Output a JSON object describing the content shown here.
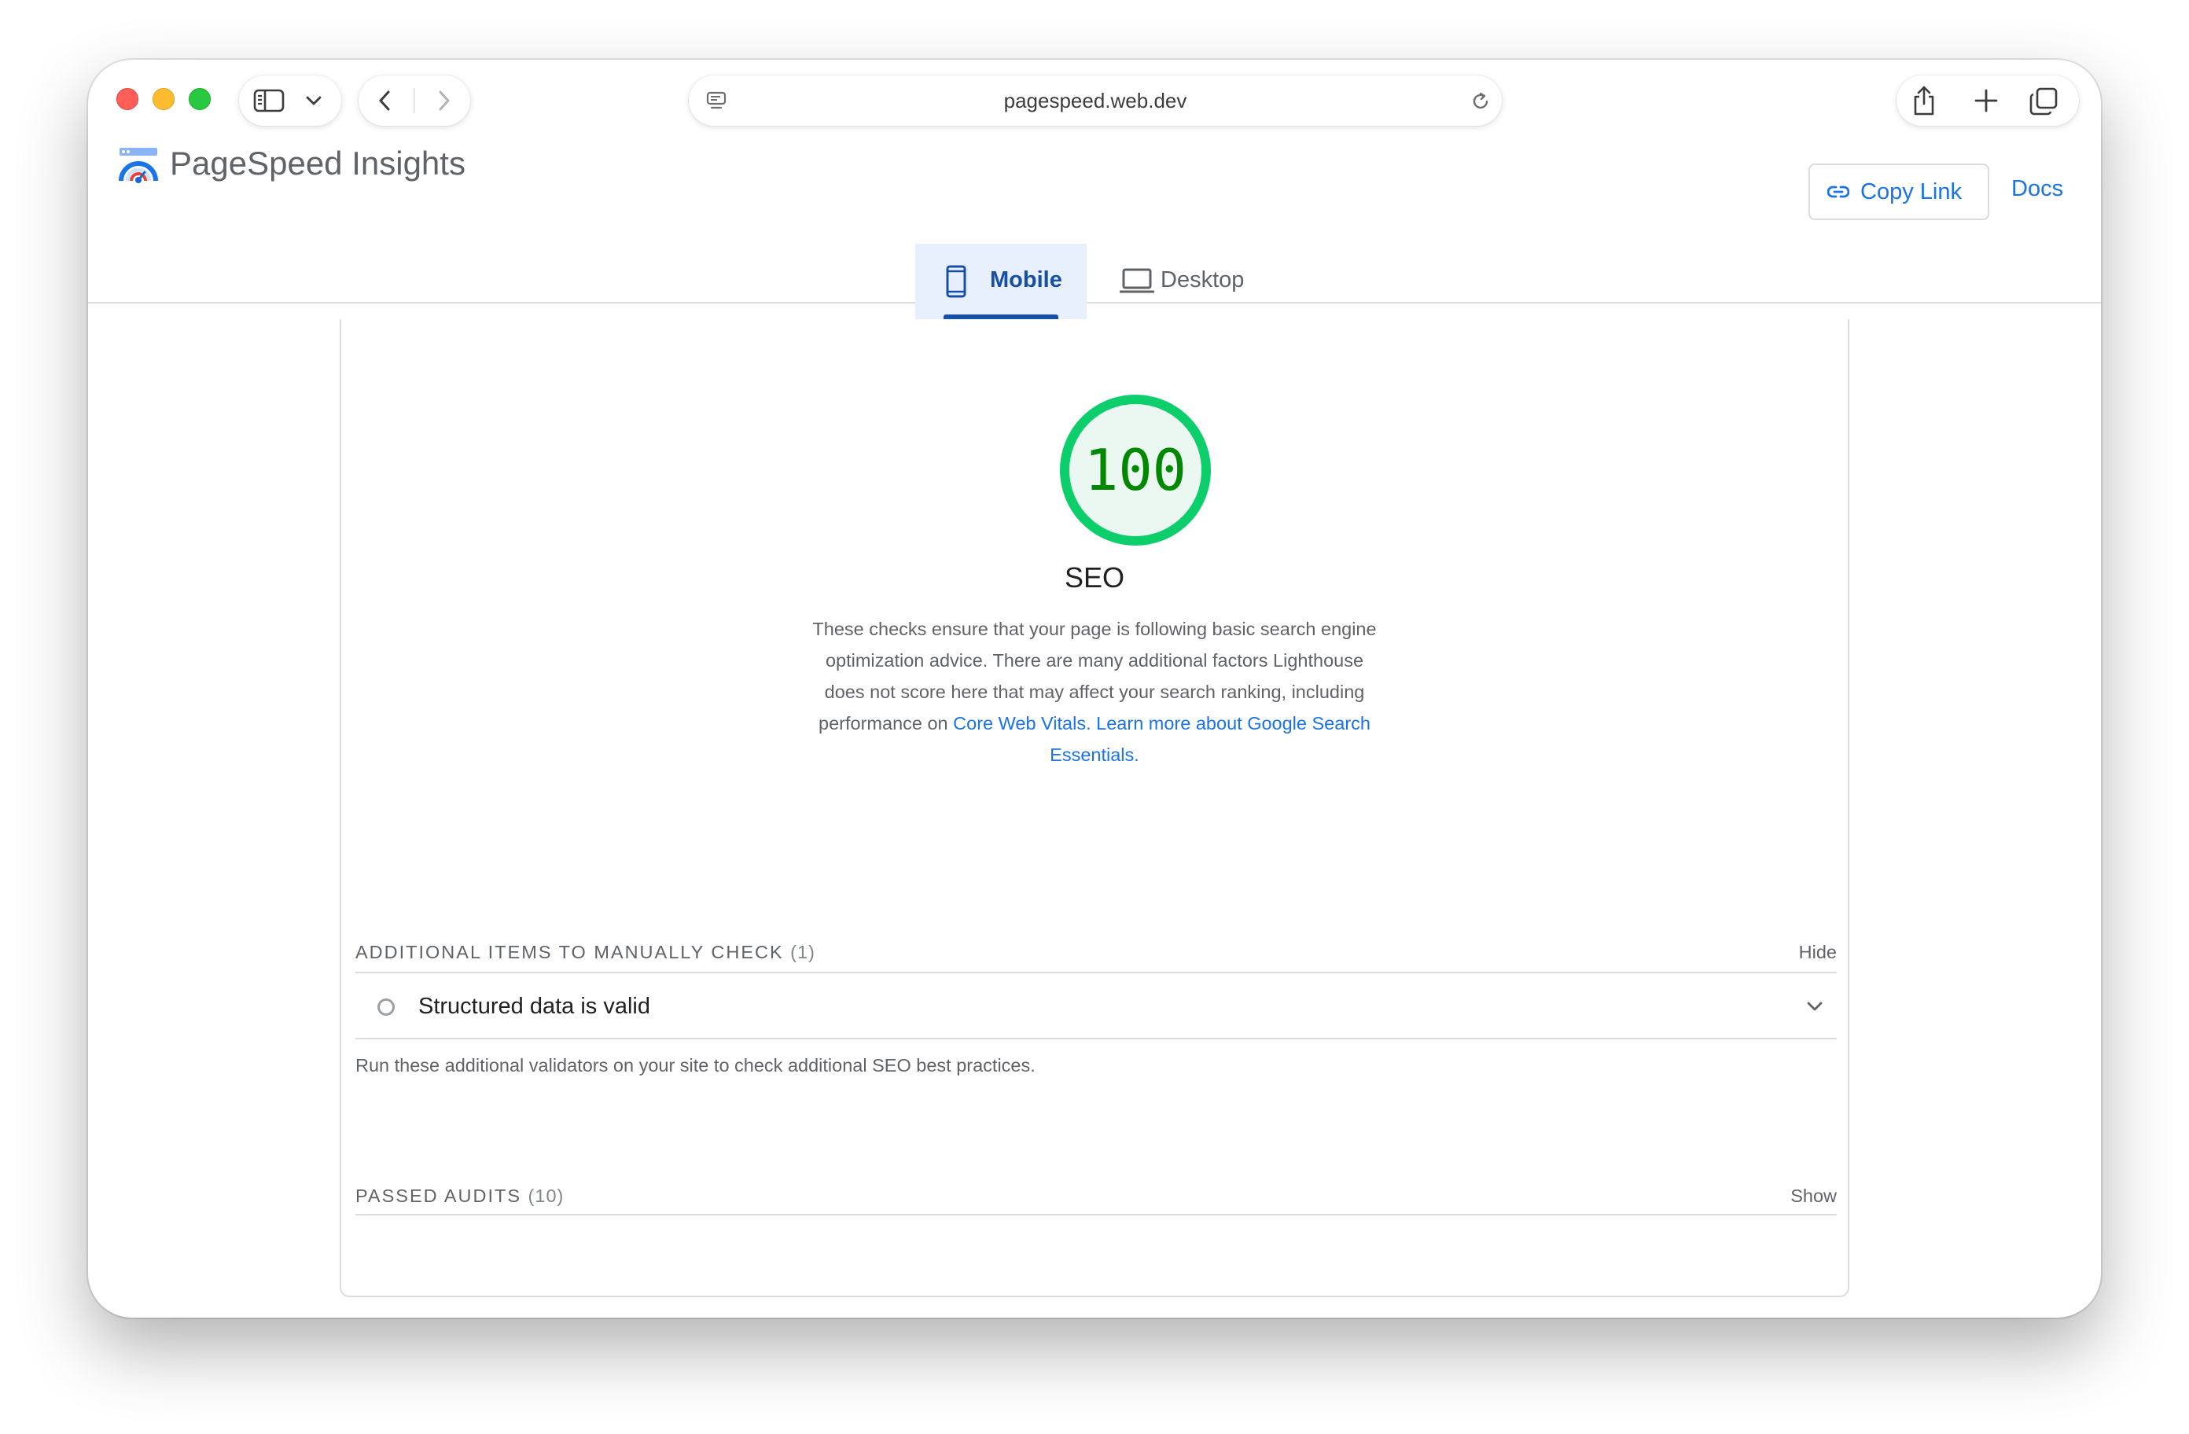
{
  "browser": {
    "url": "pagespeed.web.dev"
  },
  "header": {
    "brand": "PageSpeed Insights",
    "copy_link": "Copy Link",
    "docs": "Docs"
  },
  "tabs": {
    "mobile": "Mobile",
    "desktop": "Desktop",
    "selected": "Mobile"
  },
  "report": {
    "score": "100",
    "score_fraction": 1.0,
    "category": "SEO",
    "desc_line1": "These checks ensure that your page is following basic search engine",
    "desc_line2": "optimization advice. There are many additional factors Lighthouse",
    "desc_line3": "does not score here that may affect your search ranking, including",
    "desc_line4_prefix": "performance on ",
    "link_core_web_vitals": "Core Web Vitals",
    "desc_sep": ". ",
    "link_learn_more_a": "Learn more about Google Search",
    "link_learn_more_b": "Essentials",
    "desc_end": ".",
    "manual": {
      "heading": "ADDITIONAL ITEMS TO MANUALLY CHECK",
      "count": "(1)",
      "toggle": "Hide",
      "item": "Structured data is valid",
      "note": "Run these additional validators on your site to check additional SEO best practices."
    },
    "passed": {
      "heading": "PASSED AUDITS",
      "count": "(10)",
      "toggle": "Show"
    }
  },
  "colors": {
    "score_pass_ring": "#0cce6b",
    "score_pass_text": "#008800",
    "link": "#1a73e8",
    "tab_active": "#174ea6"
  }
}
